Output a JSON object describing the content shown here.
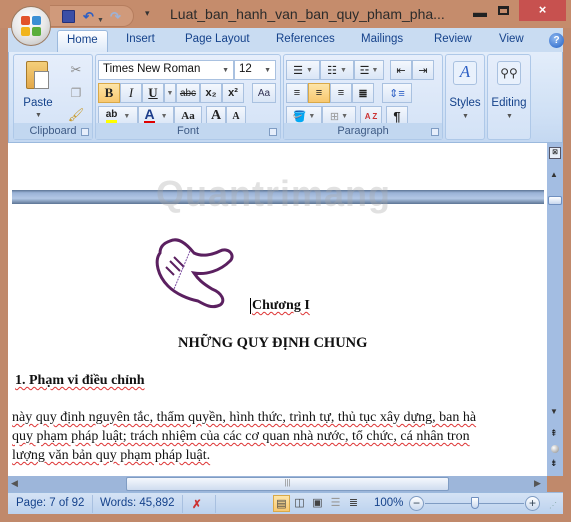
{
  "window": {
    "title": "Luat_ban_hanh_van_ban_quy_pham_pha...",
    "minimize_icon": "minimize-icon",
    "maximize_icon": "maximize-icon",
    "close_label": "×"
  },
  "quick_access": {
    "save_icon": "save-icon",
    "undo_icon": "undo-icon",
    "redo_icon": "redo-icon",
    "customize_icon": "customize-qat-icon"
  },
  "tabs": [
    {
      "label": "Home",
      "active": true
    },
    {
      "label": "Insert"
    },
    {
      "label": "Page Layout"
    },
    {
      "label": "References"
    },
    {
      "label": "Mailings"
    },
    {
      "label": "Review"
    },
    {
      "label": "View"
    }
  ],
  "help_label": "?",
  "ribbon": {
    "clipboard": {
      "label": "Clipboard",
      "paste_label": "Paste",
      "cut_icon": "scissors-icon",
      "copy_icon": "copy-icon",
      "format_painter_icon": "format-painter-icon"
    },
    "font": {
      "label": "Font",
      "font_name": "Times New Roman",
      "font_size": "12",
      "bold": "B",
      "italic": "I",
      "underline": "U",
      "strikethrough": "abc",
      "subscript": "x₂",
      "superscript": "x²",
      "clear_format_icon": "clear-formatting-icon",
      "highlight_label": "ab",
      "highlight_color": "#ffff00",
      "font_color_label": "A",
      "font_color": "#e00000",
      "change_case": "Aa",
      "grow_font": "A",
      "shrink_font": "A"
    },
    "paragraph": {
      "label": "Paragraph",
      "sort_label": "A Z",
      "pilcrow": "¶"
    },
    "styles": {
      "label": "Styles"
    },
    "editing": {
      "label": "Editing"
    }
  },
  "document": {
    "watermark": "Quantrimang",
    "chapter": "Chương I",
    "heading": "NHỮNG QUY ĐỊNH CHUNG",
    "section": "1. Phạm vi điều chỉnh",
    "lines": [
      "này quy định nguyên tắc, thẩm quyền, hình thức, trình tự, thủ tục xây dựng, ban hà",
      "quy phạm pháp luật; trách nhiệm của các cơ quan nhà nước, tổ chức, cá nhân tron",
      "lượng văn bản quy phạm pháp luật."
    ]
  },
  "status": {
    "page": "Page: 7 of 92",
    "words": "Words: 45,892",
    "proofing_icon": "proofing-error-icon",
    "zoom": "100%",
    "zoom_level_percent": 100
  }
}
